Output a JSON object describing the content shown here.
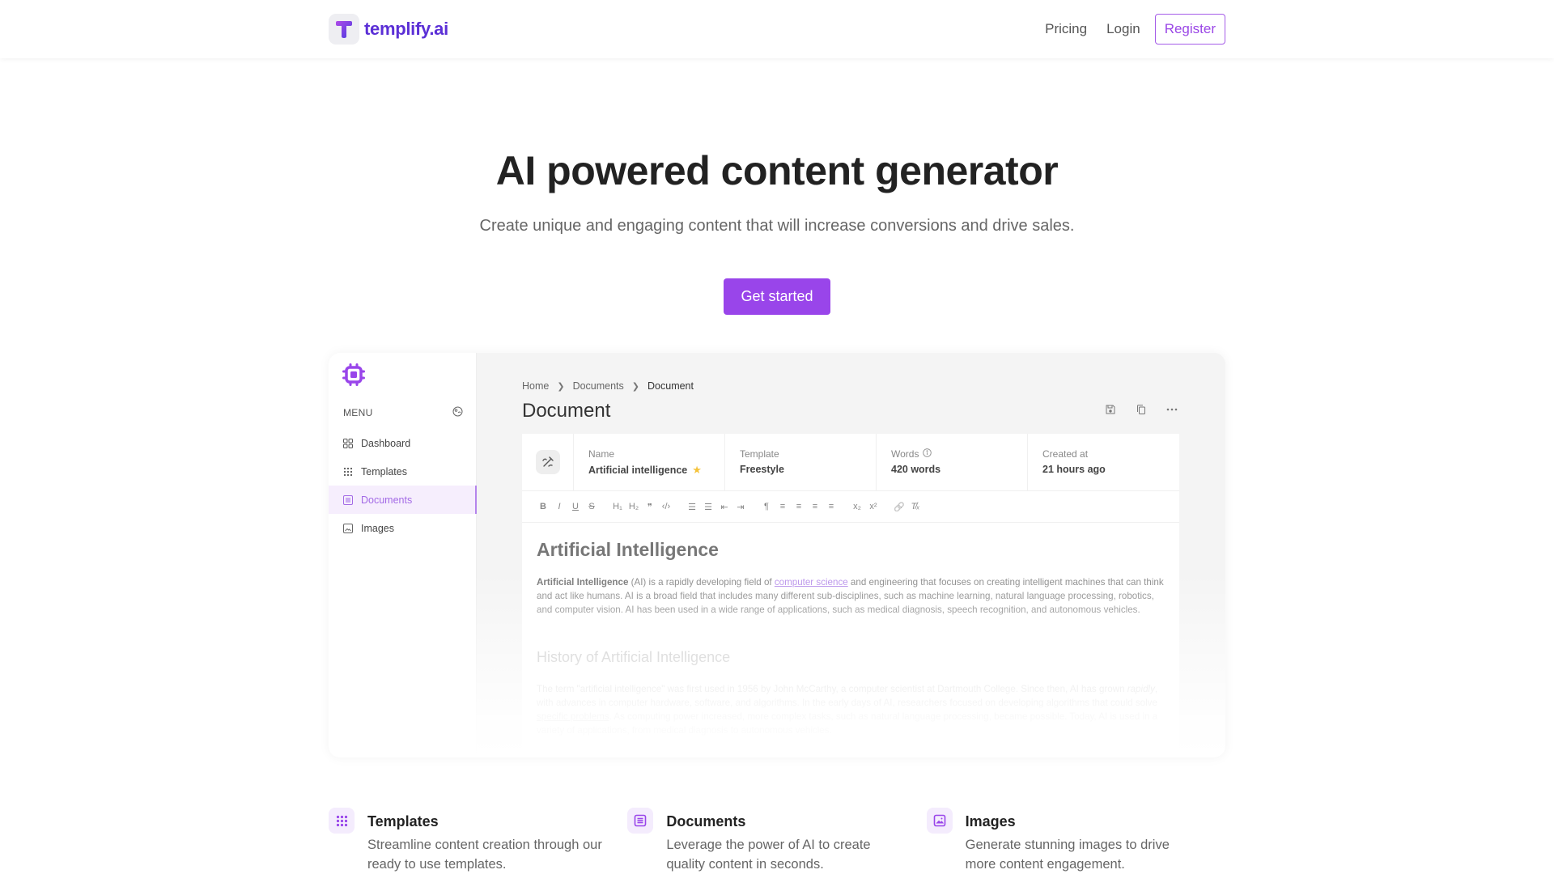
{
  "header": {
    "brand_name": "templify.ai",
    "nav": {
      "pricing": "Pricing",
      "login": "Login",
      "register": "Register"
    }
  },
  "hero": {
    "title": "AI powered content generator",
    "subtitle": "Create unique and engaging content that will increase conversions and drive sales.",
    "cta_label": "Get started"
  },
  "colors": {
    "brand": "#5b2fd6",
    "accent": "#9945ea"
  },
  "app_preview": {
    "sidebar": {
      "menu_label": "MENU",
      "items": [
        {
          "label": "Dashboard",
          "icon": "grid-icon",
          "active": false
        },
        {
          "label": "Templates",
          "icon": "dots-grid-icon",
          "active": false
        },
        {
          "label": "Documents",
          "icon": "document-icon",
          "active": true
        },
        {
          "label": "Images",
          "icon": "image-icon",
          "active": false
        }
      ]
    },
    "breadcrumb": [
      "Home",
      "Documents",
      "Document"
    ],
    "page_title": "Document",
    "actions": [
      "save-icon",
      "copy-icon",
      "more-icon"
    ],
    "meta": {
      "name_label": "Name",
      "name_value": "Artificial intelligence",
      "template_label": "Template",
      "template_value": "Freestyle",
      "words_label": "Words",
      "words_value": "420 words",
      "created_label": "Created at",
      "created_value": "21 hours ago"
    },
    "toolbar": {
      "bold": "B",
      "italic": "I",
      "underline": "U",
      "strike": "S",
      "h1": "H₁",
      "h2": "H₂",
      "quote": "❞",
      "code": "‹/›",
      "ordered_list": "☰",
      "bullet_list": "☰",
      "outdent": "⇤",
      "indent": "⇥",
      "paragraph": "¶",
      "align_left": "≡",
      "align_center": "≡",
      "align_right": "≡",
      "justify": "≡",
      "subscript": "x₂",
      "superscript": "x²",
      "link": "🔗",
      "clear_format": "T̸ₓ"
    },
    "document": {
      "heading": "Artificial Intelligence",
      "p1_bold": "Artificial Intelligence",
      "p1_a": " (AI) is a rapidly developing field of ",
      "p1_link": "computer science",
      "p1_b": " and engineering that focuses on creating intelligent machines that can think and act like humans. AI is a broad field that includes many different sub-disciplines, such as machine learning, natural language processing, robotics, and computer vision. AI has been used in a wide range of applications, such as medical diagnosis, speech recognition, and autonomous vehicles.",
      "subheading": "History of Artificial Intelligence",
      "p2_a": "The term \"artificial intelligence\" was first used in 1956 by John McCarthy, a computer scientist at Dartmouth College. Since then, AI has grown ",
      "p2_em": "rapidly",
      "p2_b": ", with advances in computer hardware, software, and algorithms. In the early days of AI, researchers focused on developing algorithms that could solve ",
      "p2_link": "specific problems",
      "p2_c": ". As computing power increased, more complex tasks, such as natural language processing, became possible. Today, AI is used in a variety of applications, from medical diagnosis to autonomous vehicles."
    }
  },
  "features": [
    {
      "title": "Templates",
      "description": "Streamline content creation through our ready to use templates.",
      "icon": "dots-grid-icon"
    },
    {
      "title": "Documents",
      "description": "Leverage the power of AI to create quality content in seconds.",
      "icon": "document-icon"
    },
    {
      "title": "Images",
      "description": "Generate stunning images to drive more content engagement.",
      "icon": "image-icon"
    }
  ]
}
